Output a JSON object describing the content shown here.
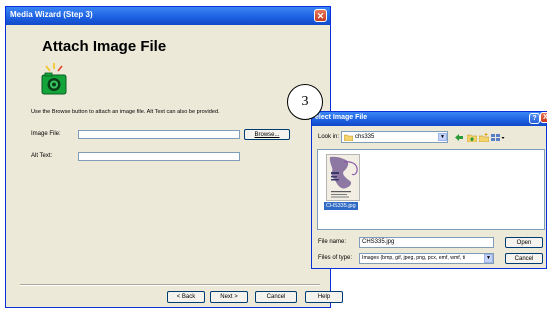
{
  "wizard": {
    "title": "Media Wizard (Step 3)",
    "heading": "Attach Image File",
    "instructions": "Use the Browse button to attach an image file.  Alt Text can also be provided.",
    "image_file_label": "Image File:",
    "image_file_value": "",
    "alt_text_label": "Alt Text:",
    "alt_text_value": "",
    "browse_label": "Browse...",
    "back_label": "< Back",
    "next_label": "Next >",
    "cancel_label": "Cancel",
    "help_label": "Help"
  },
  "callout": {
    "number": "3"
  },
  "dialog": {
    "title": "elect Image File",
    "look_in_label": "Look in:",
    "look_in_value": "chs335",
    "file_caption": "CHS335.jpg",
    "file_name_label": "File name:",
    "file_name_value": "CHS335.jpg",
    "files_of_type_label": "Files of type:",
    "files_of_type_value": "Images (bmp, gif, jpeg, png, pcx, emf, wmf, ti",
    "open_label": "Open",
    "cancel_label": "Cancel",
    "help_glyph": "?",
    "close_glyph": "X"
  },
  "icons": {
    "wizard_close": "close-icon",
    "camera": "camera-icon",
    "folder": "folder-icon",
    "back": "back-arrow-icon",
    "up": "up-folder-icon",
    "new_folder": "new-folder-icon",
    "views": "views-menu-icon"
  },
  "colors": {
    "title_bar": "#1b5fe0",
    "window_face": "#ece9d8",
    "camera_green": "#14a53a",
    "selection": "#316ac5",
    "close_red": "#c8371b"
  }
}
